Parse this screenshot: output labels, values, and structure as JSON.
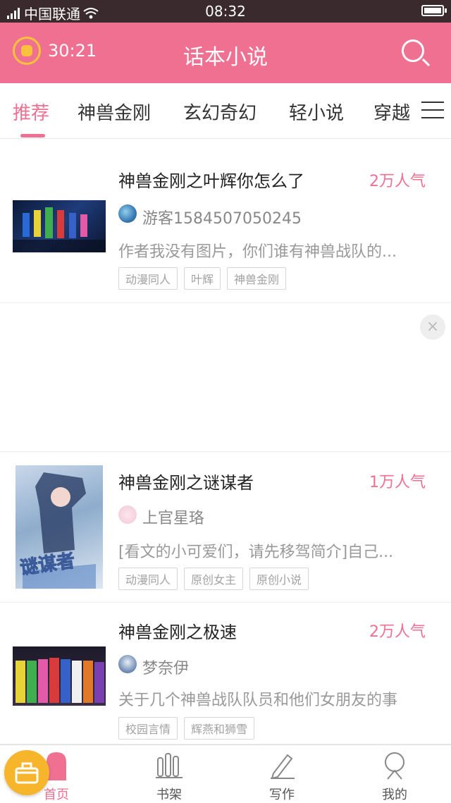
{
  "status_bar": {
    "carrier": "中国联通",
    "time": "08:32"
  },
  "header": {
    "timer": "30:21",
    "title": "话本小说"
  },
  "tabs": [
    "推荐",
    "神兽金刚",
    "玄幻奇幻",
    "轻小说",
    "穿越"
  ],
  "books": [
    {
      "title": "神兽金刚之叶辉你怎么了",
      "popularity": "2万人气",
      "author": "游客1584507050245",
      "description": "作者我没有图片，你们谁有神兽战队的...",
      "tags": [
        "动漫同人",
        "叶辉",
        "神兽金刚"
      ]
    },
    {
      "title": "神兽金刚之谜谋者",
      "popularity": "1万人气",
      "author": "上官星珞",
      "description": "[看文的小可爱们，请先移驾简介]自己...",
      "tags": [
        "动漫同人",
        "原创女主",
        "原创小说"
      ],
      "cover_text": "谜谋者"
    },
    {
      "title": "神兽金刚之极速",
      "popularity": "2万人气",
      "author": "梦奈伊",
      "description": "关于几个神兽战队队员和他们女朋友的事",
      "tags": [
        "校园言情",
        "辉燕和狮雪"
      ]
    }
  ],
  "ad": {
    "close_symbol": "×"
  },
  "bottom_nav": [
    {
      "label": "首页",
      "icon": "home-icon",
      "active": true
    },
    {
      "label": "书架",
      "icon": "bookshelf-icon",
      "active": false
    },
    {
      "label": "写作",
      "icon": "pen-icon",
      "active": false
    },
    {
      "label": "我的",
      "icon": "profile-icon",
      "active": false
    }
  ],
  "colors": {
    "accent": "#ef7091",
    "status_bar": "#3a2a2e",
    "fab": "#f7b52b"
  }
}
